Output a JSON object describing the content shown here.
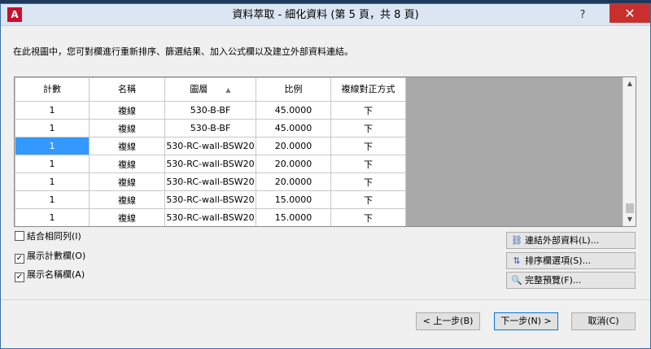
{
  "window": {
    "title": "資料萃取 - 細化資料 (第 5 頁，共 8 頁)",
    "app_icon": "A",
    "help": "?",
    "close": "✕"
  },
  "description": "在此視圖中，您可對欄進行重新排序、篩選結果、加入公式欄以及建立外部資料連結。",
  "table": {
    "columns": [
      "計數",
      "名稱",
      "圖層",
      "比例",
      "複線對正方式"
    ],
    "sort_column": "圖層",
    "rows": [
      [
        "1",
        "複線",
        "530-B-BF",
        "45.0000",
        "下"
      ],
      [
        "1",
        "複線",
        "530-B-BF",
        "45.0000",
        "下"
      ],
      [
        "1",
        "複線",
        "530-RC-wall-BSW20",
        "20.0000",
        "下"
      ],
      [
        "1",
        "複線",
        "530-RC-wall-BSW20",
        "20.0000",
        "下"
      ],
      [
        "1",
        "複線",
        "530-RC-wall-BSW20",
        "20.0000",
        "下"
      ],
      [
        "1",
        "複線",
        "530-RC-wall-BSW20",
        "15.0000",
        "下"
      ],
      [
        "1",
        "複線",
        "530-RC-wall-BSW20",
        "15.0000",
        "下"
      ]
    ],
    "selected_row": 2
  },
  "options": {
    "combine": {
      "label": "結合相同列(I)",
      "checked": false
    },
    "show_count": {
      "label": "展示計數欄(O)",
      "checked": true
    },
    "show_name": {
      "label": "展示名稱欄(A)",
      "checked": true
    }
  },
  "side_buttons": {
    "link": "連結外部資料(L)...",
    "sort": "排序欄選項(S)...",
    "preview": "完整預覽(F)..."
  },
  "nav": {
    "back": "< 上一步(B)",
    "next": "下一步(N) >",
    "cancel": "取消(C)"
  }
}
